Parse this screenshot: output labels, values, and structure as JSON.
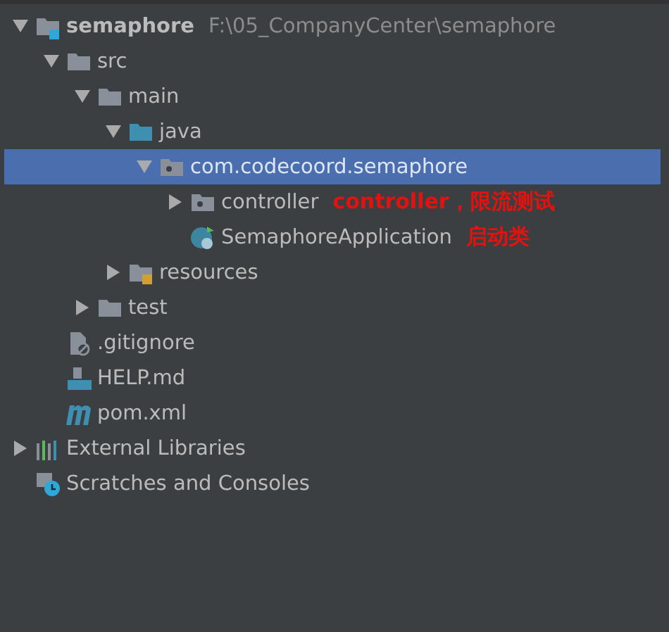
{
  "tree": [
    {
      "kind": "project",
      "label": "semaphore",
      "location": "F:\\05_CompanyCenter\\semaphore",
      "expanded": true,
      "selected": false,
      "children": [
        {
          "kind": "folder",
          "label": "src",
          "expanded": true,
          "selected": false,
          "children": [
            {
              "kind": "folder",
              "label": "main",
              "expanded": true,
              "selected": false,
              "children": [
                {
                  "kind": "source-folder",
                  "label": "java",
                  "expanded": true,
                  "selected": false,
                  "children": [
                    {
                      "kind": "package",
                      "label": "com.codecoord.semaphore",
                      "expanded": true,
                      "selected": true,
                      "children": [
                        {
                          "kind": "package",
                          "label": "controller",
                          "note": "controller，限流测试",
                          "expanded": false,
                          "selected": false
                        },
                        {
                          "kind": "class",
                          "label": "SemaphoreApplication",
                          "note": "启动类",
                          "selected": false
                        }
                      ]
                    }
                  ]
                },
                {
                  "kind": "resource-folder",
                  "label": "resources",
                  "expanded": false,
                  "selected": false
                }
              ]
            },
            {
              "kind": "folder",
              "label": "test",
              "expanded": false,
              "selected": false
            }
          ]
        },
        {
          "kind": "gitignore",
          "label": ".gitignore",
          "selected": false
        },
        {
          "kind": "markdown",
          "label": "HELP.md",
          "selected": false
        },
        {
          "kind": "maven",
          "label": "pom.xml",
          "selected": false
        }
      ]
    },
    {
      "kind": "libraries",
      "label": "External Libraries",
      "expanded": false,
      "selected": false
    },
    {
      "kind": "scratches",
      "label": "Scratches and Consoles",
      "selected": false
    }
  ]
}
